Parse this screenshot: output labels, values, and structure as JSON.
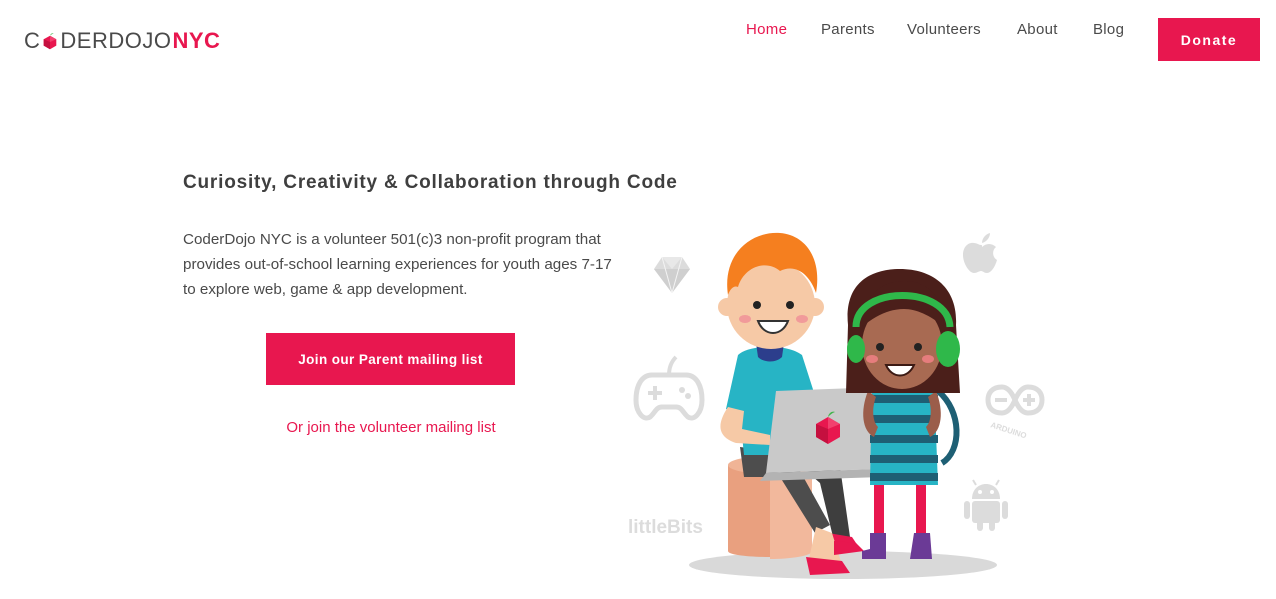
{
  "header": {
    "logo": {
      "prefix": "C",
      "middle": "DERDOJO",
      "suffix": "NYC"
    },
    "nav": [
      {
        "label": "Home",
        "active": true
      },
      {
        "label": "Parents",
        "active": false
      },
      {
        "label": "Volunteers",
        "active": false
      },
      {
        "label": "About",
        "active": false
      },
      {
        "label": "Blog",
        "active": false
      }
    ],
    "donate_label": "Donate"
  },
  "hero": {
    "headline": "Curiosity, Creativity & Collaboration through Code",
    "description": "CoderDojo NYC is a volunteer 501(c)3 non-profit program that provides out-of-school learning experiences for youth ages 7-17 to explore web, game & app development.",
    "parent_button": "Join our Parent mailing list",
    "volunteer_link": "Or join the volunteer mailing list"
  },
  "illustration": {
    "littlebits_label": "littleBits",
    "arduino_label": "ARDUINO",
    "icons": [
      "ruby-icon",
      "apple-icon",
      "gamepad-icon",
      "arduino-icon",
      "android-icon",
      "littlebits-icon"
    ]
  },
  "colors": {
    "brand": "#e8174f",
    "text": "#4a4a4a",
    "icon_gray": "#dcdcdc"
  }
}
